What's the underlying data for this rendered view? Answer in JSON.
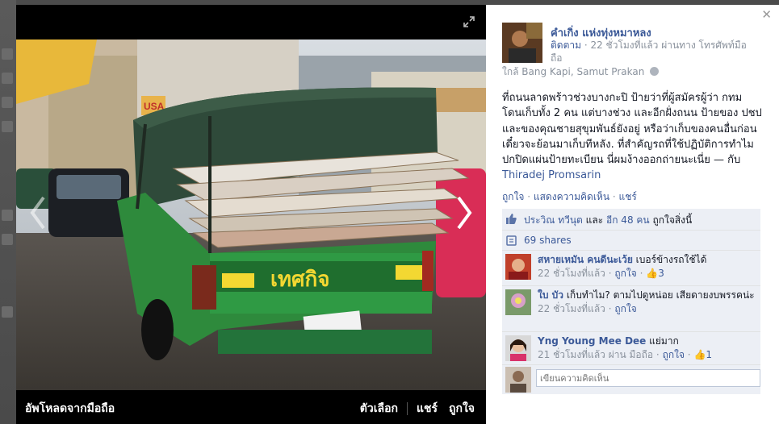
{
  "photo": {
    "upload_label": "อัพโหลดจากมือถือ",
    "actions": {
      "options": "ตัวเลือก",
      "share": "แชร์",
      "like": "ถูกใจ"
    },
    "plate_text": "เทศกิจ",
    "sign_usa": "USA"
  },
  "post": {
    "author": "คำเกิ่ง แห่งทุ่งหมาหลง",
    "follow": "ติดตาม",
    "meta_time": " · 22 ชั่วโมงที่แล้ว ผ่านทาง โทรศัพท์มือถือ",
    "location": "ใกล้ Bang Kapi, Samut Prakan",
    "body": "ที่ถนนลาดพร้าวช่วงบางกะปิ ป้ายว่าที่ผู้สมัครผู้ว่า กทม โดนเก็บทั้ง 2 คน แต่บางช่วง และอีกฝั่งถนน ป้ายของ ปชป และของคุณชายสุขุมพันธ์ยังอยู่ หรือว่าเก็บของคนอื่นก่อนเดี๋ยวจะย้อนมาเก็บทีหลัง. ที่สำคัญรถที่ใช้ปฏิบัติการทำไมปกปิดแผ่นป้ายทะเบียน นี่ผมง้างออกถ่ายนะเนี่ย — กับ ",
    "tagged": "Thiradej Promsarin",
    "actions": {
      "like": "ถูกใจ",
      "comment": "แสดงความคิดเห็น",
      "share": "แชร์",
      "sep": " · "
    },
    "likes": {
      "names": "ประวิณ ทวีนุต",
      "and": " และ ",
      "others": "อีก 48 คน",
      "suffix": " ถูกใจสิ่งนี้"
    },
    "shares": "69 shares"
  },
  "comments": [
    {
      "name": "สหายเหมัน คนดีนะเว้ย",
      "text": " เบอร์ข้างรถใช้ได้",
      "time": "22 ชั่วโมงที่แล้ว",
      "like": "ถูกใจ",
      "likes": "3"
    },
    {
      "name": "ใบ บัว",
      "text": " เก็บทำไม? ตามไปดูหน่อย เสียดายงบพรรคน่ะ",
      "time": "22 ชั่วโมงที่แล้ว",
      "like": "ถูกใจ"
    },
    {
      "name": "Yng Young Mee Dee",
      "text": " แย่มาก",
      "time": "21 ชั่วโมงที่แล้ว ผ่าน มือถือ",
      "like": "ถูกใจ",
      "likes": "1"
    }
  ],
  "composer": {
    "placeholder": "เขียนความคิดเห็น"
  }
}
